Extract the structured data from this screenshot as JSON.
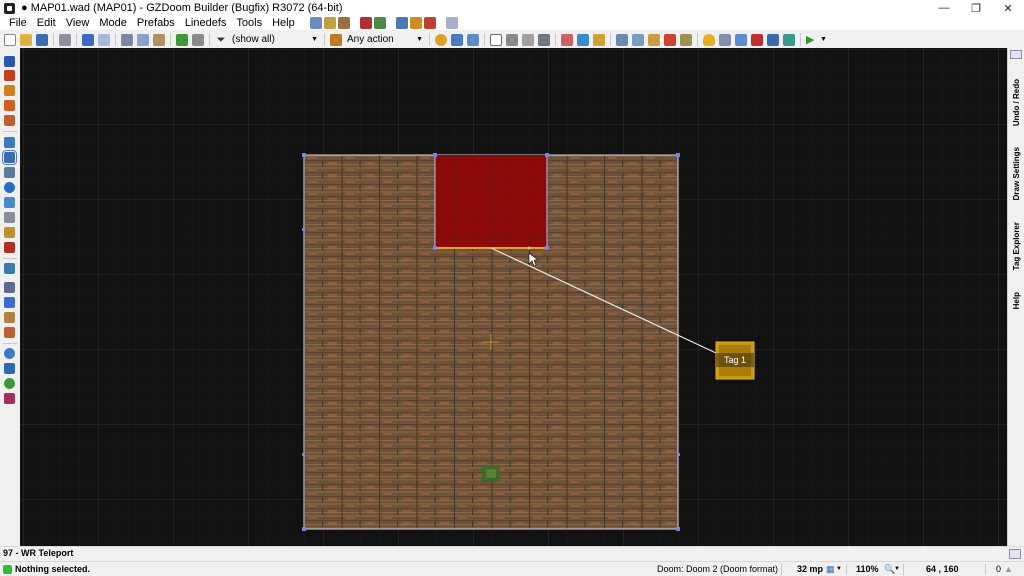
{
  "window": {
    "title": "● MAP01.wad (MAP01) - GZDoom Builder (Bugfix) R3072 (64-bit)",
    "minimize": "—",
    "restore": "❐",
    "close": "✕"
  },
  "menu": [
    "File",
    "Edit",
    "View",
    "Mode",
    "Prefabs",
    "Linedefs",
    "Tools",
    "Help"
  ],
  "toolbar": {
    "filter_value": "(show all)",
    "action_value": "Any action"
  },
  "map": {
    "tag_label": "Tag 1"
  },
  "right_tabs": [
    "Undo / Redo",
    "Draw Settings",
    "Tag Explorer",
    "Help"
  ],
  "info": {
    "linedef_action": "97 - WR Teleport"
  },
  "status": {
    "message": "Nothing selected.",
    "game_config": "Doom: Doom 2 (Doom format)",
    "grid_size": "32 mp",
    "zoom": "110%",
    "coordinates": "64 , 160",
    "warnings": "0"
  },
  "colors": {
    "canvas_bg": "#121212",
    "selected_sector": "#8b0a0a",
    "thing_fill": "#c89a10",
    "teleport_line": "#e6e6e6"
  }
}
